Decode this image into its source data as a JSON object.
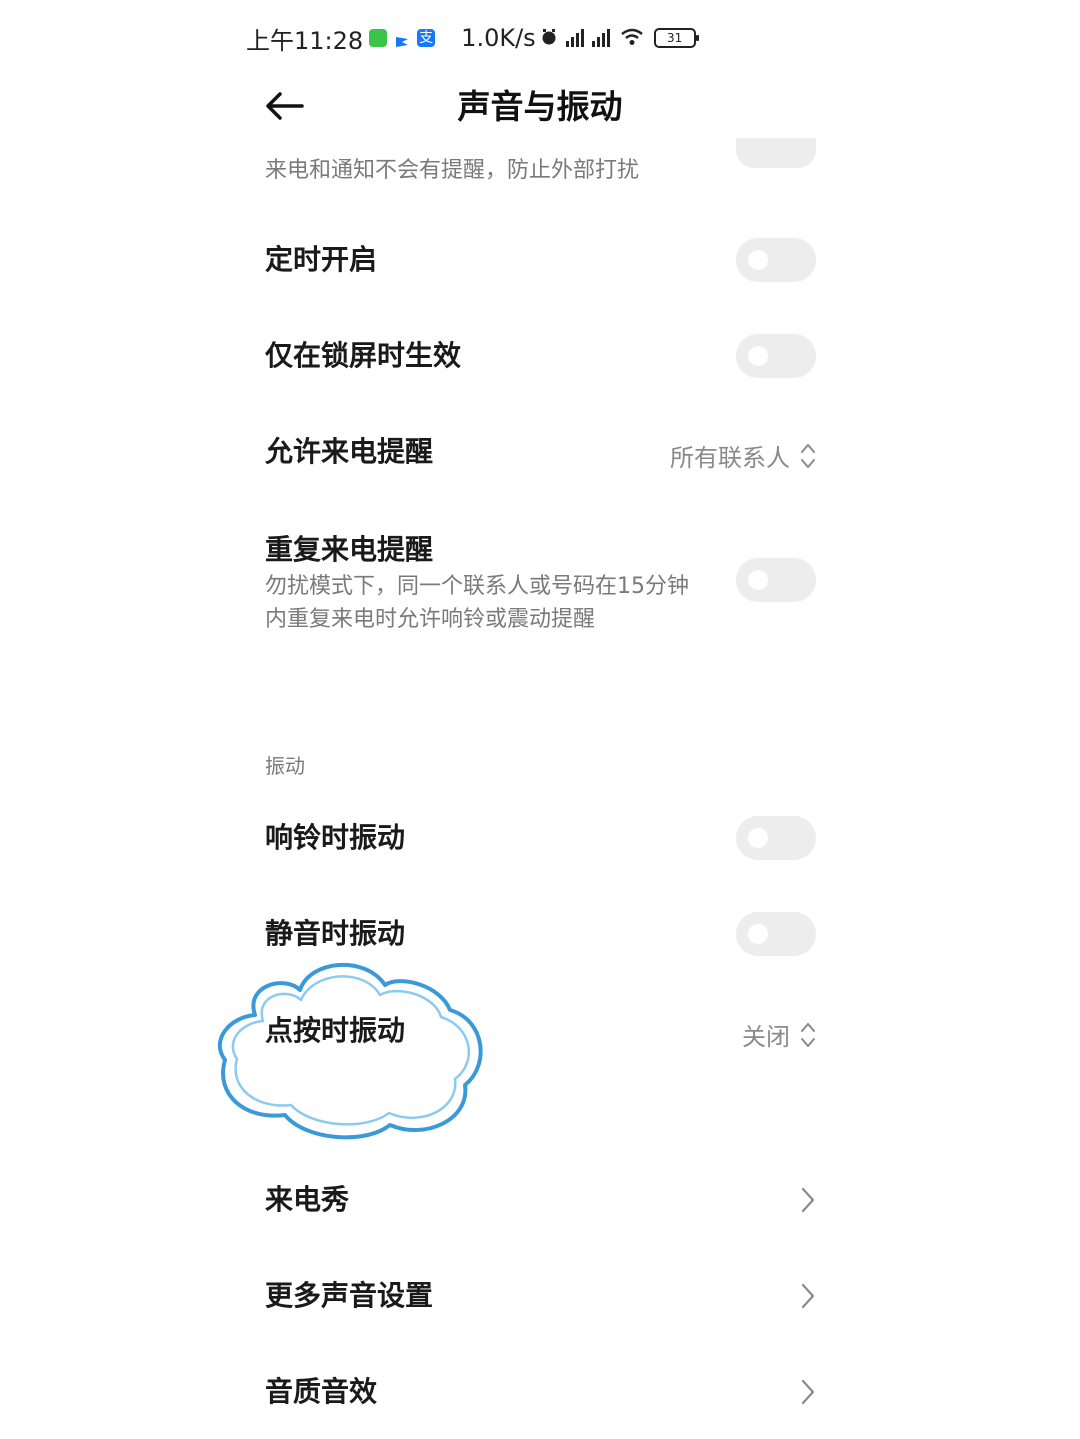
{
  "status_bar": {
    "time": "上午11:28",
    "net_speed": "1.0K/s",
    "battery_level": "31",
    "icons": [
      "message-app-icon",
      "flag-app-icon",
      "alipay-icon",
      "alarm-icon",
      "signal-icon",
      "signal-icon",
      "wifi-icon",
      "battery-icon"
    ]
  },
  "header": {
    "title": "声音与振动",
    "back_icon": "back-arrow-icon"
  },
  "partial_item": {
    "description": "来电和通知不会有提醒，防止外部打扰",
    "toggle_on": false
  },
  "dnd_settings": [
    {
      "title": "定时开启",
      "control": "toggle",
      "on": false
    },
    {
      "title": "仅在锁屏时生效",
      "control": "toggle",
      "on": false
    },
    {
      "title": "允许来电提醒",
      "control": "select",
      "value": "所有联系人"
    },
    {
      "title": "重复来电提醒",
      "description_line1": "勿扰模式下，同一个联系人或号码在15分钟",
      "description_line2": "内重复来电时允许响铃或震动提醒",
      "control": "toggle",
      "on": false
    }
  ],
  "vibration_section": {
    "label": "振动",
    "items": [
      {
        "title": "响铃时振动",
        "control": "toggle",
        "on": false
      },
      {
        "title": "静音时振动",
        "control": "toggle",
        "on": false
      },
      {
        "title": "点按时振动",
        "control": "select",
        "value": "关闭"
      }
    ]
  },
  "more_items": [
    {
      "title": "来电秀"
    },
    {
      "title": "更多声音设置"
    },
    {
      "title": "音质音效"
    }
  ],
  "colors": {
    "toggle_off_bg": "#ededed",
    "annotation_stroke": "#3a9ad9",
    "secondary_text": "#7a7a7a"
  }
}
